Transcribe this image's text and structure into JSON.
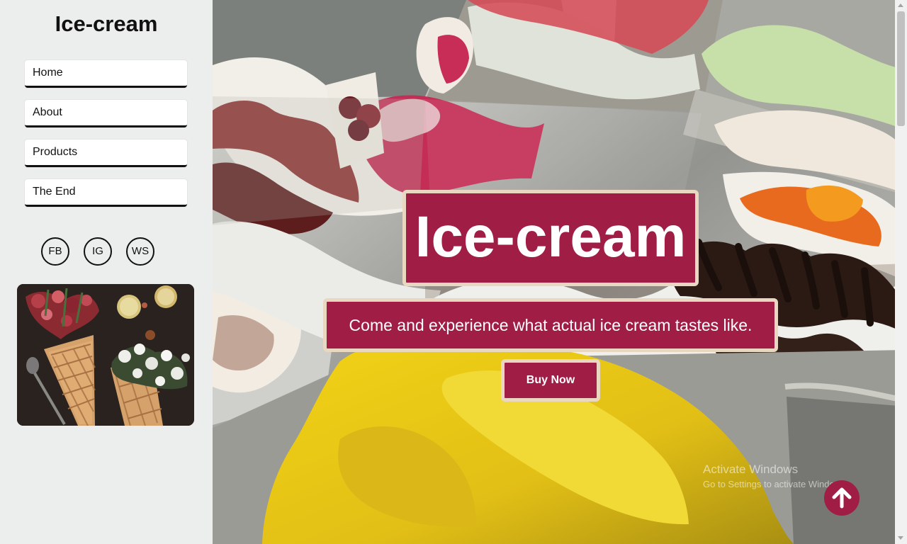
{
  "sidebar": {
    "brand": "Ice-cream",
    "nav": [
      {
        "label": "Home"
      },
      {
        "label": "About"
      },
      {
        "label": "Products"
      },
      {
        "label": "The End"
      }
    ],
    "social": [
      {
        "label": "FB"
      },
      {
        "label": "IG"
      },
      {
        "label": "WS"
      }
    ],
    "photo_icon": "flowers-in-cones-image"
  },
  "hero": {
    "title": "Ice-cream",
    "subtitle": "Come and experience what actual ice cream tastes like.",
    "cta_label": "Buy Now",
    "background_icon": "gelato-display-image",
    "accent_color": "#a01d45",
    "border_color": "#ead7c1"
  },
  "scroll_top": {
    "icon": "arrow-up-icon"
  },
  "os_watermark": {
    "line1": "Activate Windows",
    "line2": "Go to Settings to activate Windows."
  }
}
